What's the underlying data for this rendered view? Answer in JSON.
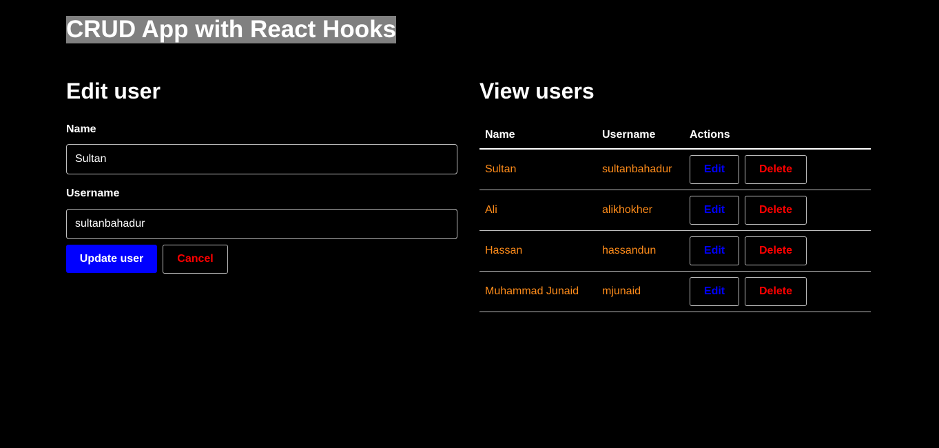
{
  "app": {
    "title": "CRUD App with React Hooks"
  },
  "edit_form": {
    "heading": "Edit user",
    "name_label": "Name",
    "name_value": "Sultan",
    "username_label": "Username",
    "username_value": "sultanbahadur",
    "update_button": "Update user",
    "cancel_button": "Cancel"
  },
  "view_users": {
    "heading": "View users",
    "columns": [
      "Name",
      "Username",
      "Actions"
    ],
    "rows": [
      {
        "name": "Sultan",
        "username": "sultanbahadur",
        "edit": "Edit",
        "delete": "Delete"
      },
      {
        "name": "Ali",
        "username": "alikhokher",
        "edit": "Edit",
        "delete": "Delete"
      },
      {
        "name": "Hassan",
        "username": "hassandun",
        "edit": "Edit",
        "delete": "Delete"
      },
      {
        "name": "Muhammad Junaid",
        "username": "mjunaid",
        "edit": "Edit",
        "delete": "Delete"
      }
    ]
  },
  "colors": {
    "background": "#000000",
    "title_highlight": "#808080",
    "primary_button": "#0000ff",
    "danger_text": "#ff0000",
    "edit_text": "#0000ff",
    "cell_text": "#ff8c1a"
  }
}
